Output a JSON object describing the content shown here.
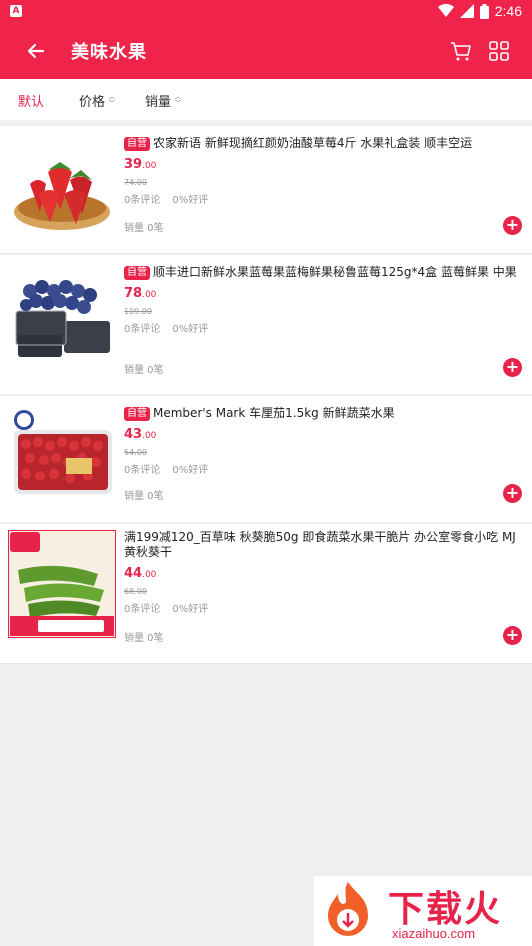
{
  "statusbar": {
    "time": "2:46",
    "notif_icon": "A"
  },
  "appbar": {
    "title": "美味水果",
    "back_icon": "arrow-left-icon",
    "cart_icon": "cart-icon",
    "grid_icon": "grid-icon"
  },
  "sortbar": {
    "tabs": [
      {
        "label": "默认",
        "active": true
      },
      {
        "label": "价格",
        "active": false
      },
      {
        "label": "销量",
        "active": false
      }
    ]
  },
  "products": [
    {
      "badge": "自营",
      "name": "农家新语 新鲜现摘红颜奶油酸草莓4斤 水果礼盒装 顺丰空运",
      "price_int": "39",
      "price_dec": ".00",
      "orig_price": "74.00",
      "reviews": "0条评论",
      "rating": "0%好评",
      "sales": "销量 0笔",
      "image": "strawberries"
    },
    {
      "badge": "自营",
      "name": "顺丰进口新鲜水果蓝莓果蓝梅鲜果秘鲁蓝莓125g*4盒 蓝莓鲜果 中果",
      "price_int": "78",
      "price_dec": ".00",
      "orig_price": "109.00",
      "reviews": "0条评论",
      "rating": "0%好评",
      "sales": "销量 0笔",
      "image": "blueberries"
    },
    {
      "badge": "自营",
      "name": "Member's Mark 车厘茄1.5kg 新鲜蔬菜水果",
      "price_int": "43",
      "price_dec": ".00",
      "orig_price": "54.00",
      "reviews": "0条评论",
      "rating": "0%好评",
      "sales": "销量 0笔",
      "image": "cherry-tomatoes"
    },
    {
      "badge": "",
      "name": "满199减120_百草味 秋葵脆50g 即食蔬菜水果干脆片 办公室零食小吃 MJ 黄秋葵干",
      "price_int": "44",
      "price_dec": ".00",
      "orig_price": "68.00",
      "reviews": "0条评论",
      "rating": "0%好评",
      "sales": "销量 0笔",
      "image": "okra-chips"
    }
  ],
  "watermark": {
    "text": "下载火",
    "url": "xiazaihuo.com"
  },
  "colors": {
    "brand": "#f0234a",
    "price": "#e8234a"
  }
}
